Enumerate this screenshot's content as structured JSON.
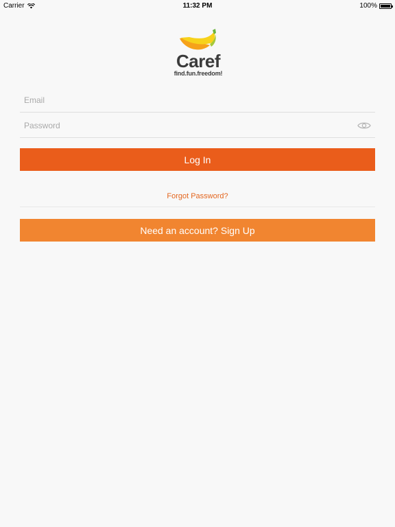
{
  "status_bar": {
    "carrier": "Carrier",
    "time": "11:32 PM",
    "battery": "100%"
  },
  "logo": {
    "word": "Caref",
    "tagline": "find.fun.freedom!"
  },
  "form": {
    "email_placeholder": "Email",
    "email_value": "",
    "password_placeholder": "Password",
    "password_value": ""
  },
  "actions": {
    "login_label": "Log In",
    "forgot_label": "Forgot Password?",
    "signup_label": "Need an account? Sign Up"
  },
  "colors": {
    "login_button": "#ea5d1b",
    "signup_button": "#f18530",
    "link": "#e3661f",
    "background": "#f8f8f8"
  },
  "icons": [
    "wifi-icon",
    "battery-icon",
    "banana-logo-icon",
    "eye-icon"
  ]
}
